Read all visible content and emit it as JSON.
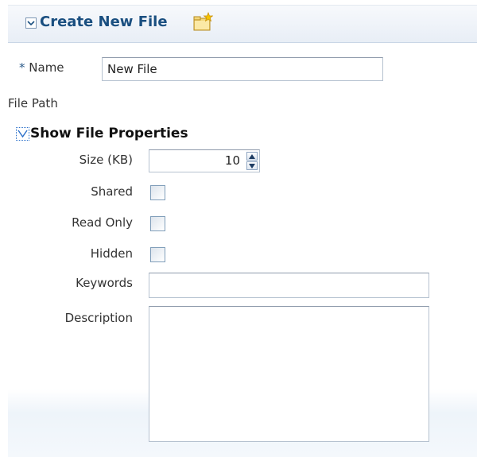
{
  "header": {
    "title": "Create New File",
    "disclosure_icon": "collapse-chevron-icon",
    "folder_icon": "new-folder-icon"
  },
  "form": {
    "name_required_mark": "*",
    "name_label": "Name",
    "name_value": "New File",
    "file_path_label": "File Path"
  },
  "properties": {
    "toggle_label": "Show File Properties",
    "toggle_icon": "expand-toggle-icon",
    "size_label": "Size (KB)",
    "size_value": "10",
    "shared_label": "Shared",
    "shared_checked": false,
    "read_only_label": "Read Only",
    "read_only_checked": false,
    "hidden_label": "Hidden",
    "hidden_checked": false,
    "keywords_label": "Keywords",
    "keywords_value": "",
    "description_label": "Description",
    "description_value": ""
  },
  "colors": {
    "header_title": "#1a4f80",
    "header_bg": "#e8eef6",
    "field_border": "#b6c2d0",
    "checkbox_border": "#7f9db9"
  }
}
